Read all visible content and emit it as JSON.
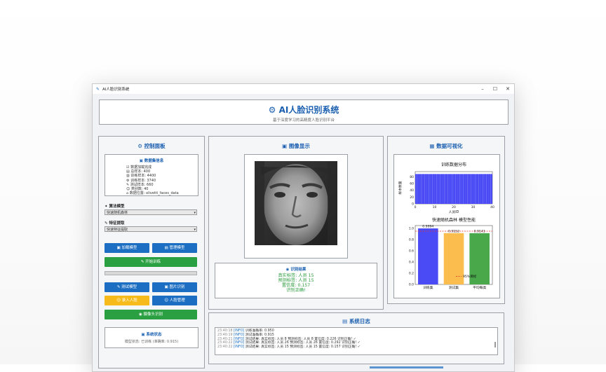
{
  "window": {
    "title": "AI人脸识别系统",
    "app_icon": "feather-icon"
  },
  "header": {
    "title": "AI人脸识别系统",
    "subtitle": "基于深度学习的高精度人脸识别平台"
  },
  "control_panel": {
    "title": "控制面板",
    "dataset": {
      "title": "数据集信息",
      "lines": [
        "数据加载完成",
        "总样本: 400",
        "训练样本: 4400",
        "训练样本: 3740",
        "测试样本: 660",
        "类别数: 40",
        "数据位置: olivetti_faces_data"
      ]
    },
    "algorithm_label": "算法模型",
    "algorithm_value": "快速随机森林",
    "feature_label": "特征提取",
    "feature_value": "快速特征提取",
    "buttons": {
      "load_model": "加载模型",
      "manage_model": "管理模型",
      "start_training": "开始训练",
      "test_model": "测试模型",
      "image_recognition": "图片识别",
      "enroll_face": "录入人脸",
      "face_management": "人脸管理",
      "camera_recognition": "摄像头识别"
    },
    "progress": 0,
    "status_title": "系统状态",
    "status_text": "模型状态: 已训练 (准确率: 0.915)"
  },
  "image_panel": {
    "title": "图像显示",
    "result_title": "识别结果",
    "result_lines": [
      "真实标签: 人员 15",
      "预测标签: 人员 15",
      "置信度: 0.157",
      "识别正确!"
    ]
  },
  "viz_panel": {
    "title": "数据可视化"
  },
  "chart_data": [
    {
      "type": "bar",
      "title": "训练数据分布",
      "xlabel": "人员ID",
      "ylabel": "样本数量",
      "xlim": [
        0,
        40
      ],
      "ylim": [
        0,
        95
      ],
      "xticks": [
        0,
        10,
        20,
        30,
        40
      ],
      "yticks": [
        0,
        20,
        40,
        60,
        80
      ],
      "bar_color": "#4b4bf6",
      "values": [
        88,
        88,
        88,
        88,
        88,
        88,
        88,
        88,
        88,
        88,
        88,
        88,
        88,
        88,
        88,
        88,
        88,
        88,
        88,
        88,
        88,
        88,
        88,
        88,
        88,
        88,
        88,
        88,
        88,
        88,
        88,
        88,
        88,
        88,
        88,
        88,
        88,
        88,
        88,
        88
      ]
    },
    {
      "type": "bar",
      "title": "快速随机森林 模型性能",
      "categories": [
        "训练集",
        "测试集",
        "平均每类"
      ],
      "values": [
        0.9994,
        0.9152,
        0.9143
      ],
      "value_labels": [
        "0.9994",
        "0.9152",
        "0.9143"
      ],
      "colors": [
        "#4b4bf6",
        "#fbbd4e",
        "#48a84a"
      ],
      "ylim": [
        0,
        1.05
      ],
      "yticks": [
        "0.0",
        "0.2",
        "0.4",
        "0.6",
        "0.8",
        "1.0"
      ],
      "reference_line": {
        "value": 0.95,
        "label": "95%目标",
        "color": "#e03030"
      }
    }
  ],
  "log_panel": {
    "title": "系统日志",
    "lines": [
      {
        "ts": "23:40:18",
        "lv": "[INFO]",
        "msg": "训练准确率: 0.950"
      },
      {
        "ts": "23:40:19",
        "lv": "[INFO]",
        "msg": "测试准确率: 0.915"
      },
      {
        "ts": "23:40:21",
        "lv": "[INFO]",
        "msg": "测试结果: 真实标签: 人员 8 预测标签: 人员 8 置信度: 0.226 识别正确! ✓"
      },
      {
        "ts": "23:40:22",
        "lv": "[INFO]",
        "msg": "测试结果: 真实标签: 人员 26 预测标签: 人员 26 置信度: 0.292 识别正确! ✓"
      },
      {
        "ts": "23:40:22",
        "lv": "[INFO]",
        "msg": "测试结果: 真实标签: 人员 15 预测标签: 人员 15 置信度: 0.157 识别正确! ✓"
      }
    ]
  }
}
